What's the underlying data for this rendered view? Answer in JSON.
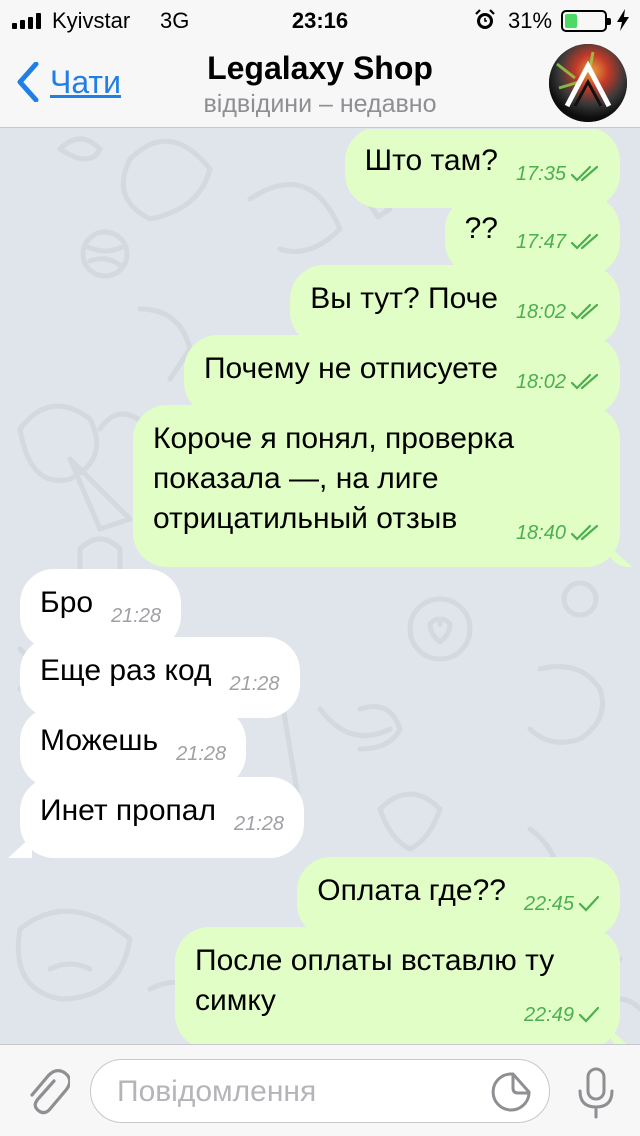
{
  "status_bar": {
    "carrier": "Kyivstar",
    "network": "3G",
    "time": "23:16",
    "battery_percent": "31%",
    "battery_level": 0.31,
    "icons": [
      "signal-icon",
      "alarm-icon",
      "battery-icon",
      "charging-icon"
    ]
  },
  "nav": {
    "back_label": "Чати",
    "title": "Legalaxy Shop",
    "subtitle": "відвідини – недавно",
    "icons": [
      "chevron-left-icon",
      "avatar"
    ]
  },
  "messages": [
    {
      "direction": "out",
      "text": "Што там?",
      "time": "17:35",
      "status": "read"
    },
    {
      "direction": "out",
      "text": "??",
      "time": "17:47",
      "status": "read"
    },
    {
      "direction": "out",
      "text": "Вы тут? Поче",
      "time": "18:02",
      "status": "read"
    },
    {
      "direction": "out",
      "text": "Почему не отписуете",
      "time": "18:02",
      "status": "read"
    },
    {
      "direction": "out",
      "text": "Короче я понял, проверка\nпоказала —, на лиге\nотрицатильный отзыв",
      "time": "18:40",
      "status": "read"
    },
    {
      "direction": "in",
      "text": "Бро",
      "time": "21:28"
    },
    {
      "direction": "in",
      "text": "Еще раз код",
      "time": "21:28"
    },
    {
      "direction": "in",
      "text": "Можешь",
      "time": "21:28"
    },
    {
      "direction": "in",
      "text": "Инет пропал",
      "time": "21:28"
    },
    {
      "direction": "out",
      "text": "Оплата где??",
      "time": "22:45",
      "status": "delivered"
    },
    {
      "direction": "out",
      "text": "После оплаты вставлю ту\nсимку",
      "time": "22:49",
      "status": "delivered"
    }
  ],
  "input_bar": {
    "placeholder": "Повідомлення",
    "icons": [
      "paperclip-icon",
      "sticker-icon",
      "microphone-icon"
    ]
  },
  "colors": {
    "accent": "#1f7fe5",
    "outgoing_bubble": "#e1fec6",
    "incoming_bubble": "#ffffff",
    "check": "#4caf50",
    "chat_background": "#dfe5ea"
  }
}
